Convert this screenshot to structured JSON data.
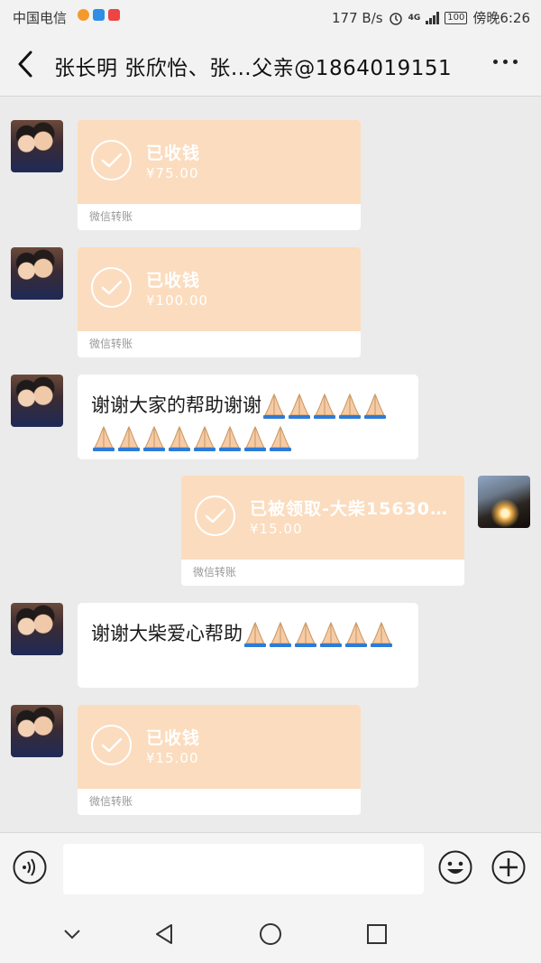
{
  "status_bar": {
    "carrier": "中国电信",
    "net_speed": "177 B/s",
    "network": "4G",
    "battery": "100",
    "time": "傍晚6:26"
  },
  "header": {
    "title": "张长明 张欣怡、张…父亲@1864019151"
  },
  "messages": [
    {
      "type": "transfer",
      "side": "left",
      "status": "已收钱",
      "amount": "¥75.00",
      "footer": "微信转账"
    },
    {
      "type": "transfer",
      "side": "left",
      "status": "已收钱",
      "amount": "¥100.00",
      "footer": "微信转账"
    },
    {
      "type": "text",
      "side": "left",
      "text": "谢谢大家的帮助谢谢"
    },
    {
      "type": "transfer",
      "side": "right",
      "status": "已被领取-大柴15630…",
      "amount": "¥15.00",
      "footer": "微信转账"
    },
    {
      "type": "text",
      "side": "left",
      "text": "谢谢大柴爱心帮助"
    },
    {
      "type": "transfer",
      "side": "left",
      "status": "已收钱",
      "amount": "¥15.00",
      "footer": "微信转账"
    }
  ],
  "icons": {
    "back": "chevron-left-icon",
    "more": "more-dots-icon",
    "check": "check-circle-icon",
    "emoji": "folded-hands-emoji",
    "voice": "voice-icon",
    "smile": "emoji-icon",
    "plus": "plus-icon"
  },
  "colors": {
    "transfer_bg": "#fbdcbe",
    "chat_bg": "#ebebeb"
  }
}
